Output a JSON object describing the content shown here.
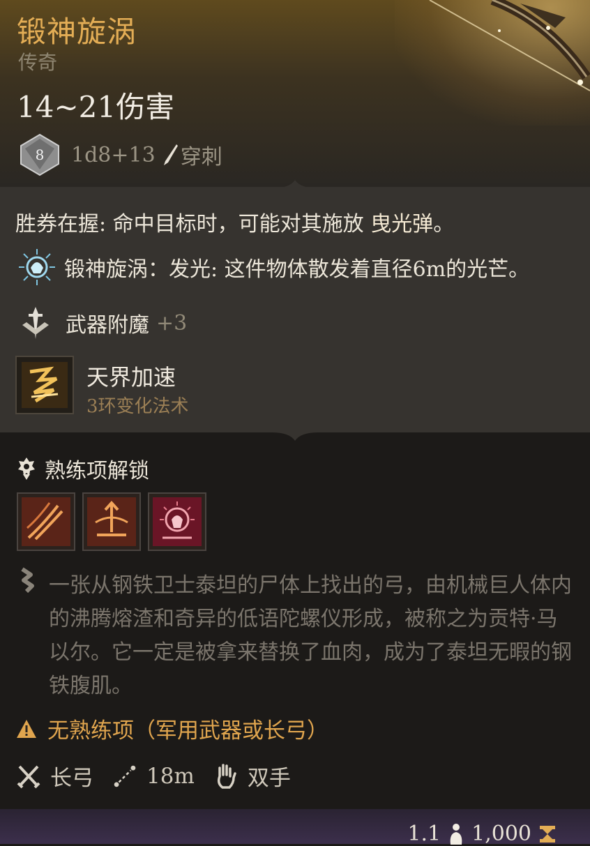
{
  "item": {
    "name": "锻神旋涡",
    "rarity": "传奇",
    "damage": "14~21伤害",
    "dice_label": "8",
    "dice_formula": "1d8+13",
    "damage_type": "穿刺"
  },
  "passive": {
    "label": "胜券在握:",
    "text": " 命中目标时，可能对其施放 ",
    "spell": "曳光弹",
    "end": "。"
  },
  "light": {
    "text": "锻神旋涡：发光: 这件物体散发着直径6m的光芒。"
  },
  "enchant": {
    "label": "武器附魔",
    "bonus": "+3"
  },
  "spell": {
    "name": "天界加速",
    "level": "3环变化法术"
  },
  "proficiency": {
    "title": "熟练项解锁",
    "actions": [
      "sweeping-arrows-icon",
      "piercing-arrow-icon",
      "mobile-shot-icon"
    ]
  },
  "description": "一张从钢铁卫士泰坦的尸体上找出的弓，由机械巨人体内的沸腾熔渣和奇异的低语陀螺仪形成，被称之为贡特·马以尔。它一定是被拿来替换了血肉，成为了泰坦无暇的钢铁腹肌。",
  "warning": "无熟练项（军用武器或长弓）",
  "stats": {
    "weapon_type": "长弓",
    "range": "18m",
    "handedness": "双手"
  },
  "footer": {
    "weight": "1.1",
    "price": "1,000"
  },
  "colors": {
    "title": "#e3ad55",
    "warning": "#e0a54e",
    "footer": "#3c2f4c"
  }
}
